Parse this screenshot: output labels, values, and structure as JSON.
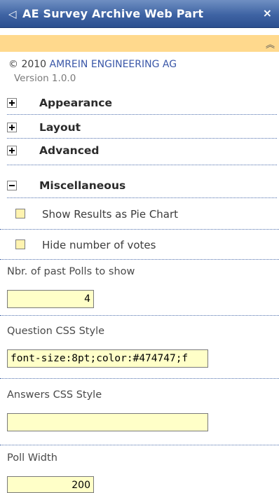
{
  "header": {
    "arrow_glyph": "◁",
    "title": "AE Survey Archive Web Part",
    "close_glyph": "×"
  },
  "toolbar": {
    "collapse_glyph": "︽"
  },
  "info": {
    "copyright_prefix": "© 2010 ",
    "company": "AMREIN ENGINEERING AG",
    "version": "Version 1.0.0"
  },
  "sections": {
    "appearance": "Appearance",
    "layout": "Layout",
    "advanced": "Advanced",
    "miscellaneous": "Miscellaneous"
  },
  "fields": {
    "show_pie_label": "Show Results as Pie Chart",
    "hide_votes_label": "Hide number of votes",
    "past_polls_label": "Nbr. of past Polls to show",
    "past_polls_value": "4",
    "question_css_label": "Question CSS Style",
    "question_css_value": "font-size:8pt;color:#474747;f",
    "answers_css_label": "Answers CSS Style",
    "answers_css_value": "",
    "poll_width_label": "Poll Width",
    "poll_width_value": "200"
  },
  "colors": {
    "header": "#3e63a3",
    "orange_bar": "#ffd98d",
    "input_bg": "#ffffc8"
  }
}
